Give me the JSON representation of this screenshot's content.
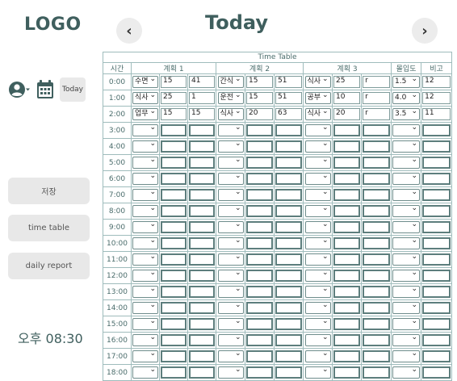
{
  "logo": "LOGO",
  "date_label": "Today",
  "nav": {
    "prev": "‹",
    "next": "›"
  },
  "toolbar": {
    "today_label": "Today"
  },
  "sidebar": {
    "save_label": "저장",
    "timetable_label": "time table",
    "report_label": "daily report"
  },
  "clock": "오후 08:30",
  "table": {
    "caption": "Time Table",
    "headers": [
      "시간",
      "계획 1",
      "계획 2",
      "계획 3",
      "몰입도",
      "비고"
    ],
    "rows": [
      {
        "time": "0:00",
        "p1": [
          "수면",
          "15",
          "41"
        ],
        "p2": [
          "간식",
          "15",
          "51"
        ],
        "p3": [
          "식사",
          "25",
          "r"
        ],
        "focus": "1.5",
        "note": "12"
      },
      {
        "time": "1:00",
        "p1": [
          "식사",
          "25",
          "1"
        ],
        "p2": [
          "운전",
          "15",
          "51"
        ],
        "p3": [
          "공부",
          "10",
          "r"
        ],
        "focus": "4.0",
        "note": "12"
      },
      {
        "time": "2:00",
        "p1": [
          "업무",
          "15",
          "15"
        ],
        "p2": [
          "식사",
          "20",
          "63"
        ],
        "p3": [
          "식사",
          "20",
          "r"
        ],
        "focus": "3.5",
        "note": "11"
      },
      {
        "time": "3:00",
        "p1": [
          "",
          "",
          ""
        ],
        "p2": [
          "",
          "",
          ""
        ],
        "p3": [
          "",
          "",
          ""
        ],
        "focus": "",
        "note": ""
      },
      {
        "time": "4:00",
        "p1": [
          "",
          "",
          ""
        ],
        "p2": [
          "",
          "",
          ""
        ],
        "p3": [
          "",
          "",
          ""
        ],
        "focus": "",
        "note": ""
      },
      {
        "time": "5:00",
        "p1": [
          "",
          "",
          ""
        ],
        "p2": [
          "",
          "",
          ""
        ],
        "p3": [
          "",
          "",
          ""
        ],
        "focus": "",
        "note": ""
      },
      {
        "time": "6:00",
        "p1": [
          "",
          "",
          ""
        ],
        "p2": [
          "",
          "",
          ""
        ],
        "p3": [
          "",
          "",
          ""
        ],
        "focus": "",
        "note": ""
      },
      {
        "time": "7:00",
        "p1": [
          "",
          "",
          ""
        ],
        "p2": [
          "",
          "",
          ""
        ],
        "p3": [
          "",
          "",
          ""
        ],
        "focus": "",
        "note": ""
      },
      {
        "time": "8:00",
        "p1": [
          "",
          "",
          ""
        ],
        "p2": [
          "",
          "",
          ""
        ],
        "p3": [
          "",
          "",
          ""
        ],
        "focus": "",
        "note": ""
      },
      {
        "time": "9:00",
        "p1": [
          "",
          "",
          ""
        ],
        "p2": [
          "",
          "",
          ""
        ],
        "p3": [
          "",
          "",
          ""
        ],
        "focus": "",
        "note": ""
      },
      {
        "time": "10:00",
        "p1": [
          "",
          "",
          ""
        ],
        "p2": [
          "",
          "",
          ""
        ],
        "p3": [
          "",
          "",
          ""
        ],
        "focus": "",
        "note": ""
      },
      {
        "time": "11:00",
        "p1": [
          "",
          "",
          ""
        ],
        "p2": [
          "",
          "",
          ""
        ],
        "p3": [
          "",
          "",
          ""
        ],
        "focus": "",
        "note": ""
      },
      {
        "time": "12:00",
        "p1": [
          "",
          "",
          ""
        ],
        "p2": [
          "",
          "",
          ""
        ],
        "p3": [
          "",
          "",
          ""
        ],
        "focus": "",
        "note": ""
      },
      {
        "time": "13:00",
        "p1": [
          "",
          "",
          ""
        ],
        "p2": [
          "",
          "",
          ""
        ],
        "p3": [
          "",
          "",
          ""
        ],
        "focus": "",
        "note": ""
      },
      {
        "time": "14:00",
        "p1": [
          "",
          "",
          ""
        ],
        "p2": [
          "",
          "",
          ""
        ],
        "p3": [
          "",
          "",
          ""
        ],
        "focus": "",
        "note": ""
      },
      {
        "time": "15:00",
        "p1": [
          "",
          "",
          ""
        ],
        "p2": [
          "",
          "",
          ""
        ],
        "p3": [
          "",
          "",
          ""
        ],
        "focus": "",
        "note": ""
      },
      {
        "time": "16:00",
        "p1": [
          "",
          "",
          ""
        ],
        "p2": [
          "",
          "",
          ""
        ],
        "p3": [
          "",
          "",
          ""
        ],
        "focus": "",
        "note": ""
      },
      {
        "time": "17:00",
        "p1": [
          "",
          "",
          ""
        ],
        "p2": [
          "",
          "",
          ""
        ],
        "p3": [
          "",
          "",
          ""
        ],
        "focus": "",
        "note": ""
      },
      {
        "time": "18:00",
        "p1": [
          "",
          "",
          ""
        ],
        "p2": [
          "",
          "",
          ""
        ],
        "p3": [
          "",
          "",
          ""
        ],
        "focus": "",
        "note": ""
      }
    ]
  },
  "colors": {
    "primary": "#3f5f5e",
    "grid": "#9fbcbc",
    "button_bg": "#e8e8e8"
  },
  "icons": [
    "user-circle-icon",
    "calendar-icon",
    "chevron-left-icon",
    "chevron-right-icon",
    "dropdown-arrow-icon"
  ]
}
